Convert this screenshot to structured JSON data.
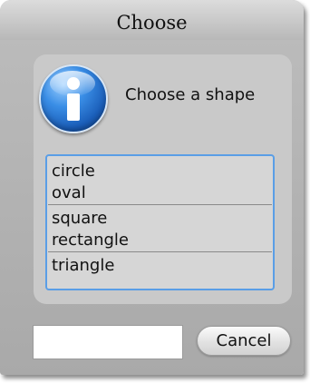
{
  "dialog": {
    "title": "Choose",
    "message": "Choose a shape",
    "icon": "info-icon",
    "list": {
      "groups": [
        [
          "circle",
          "oval"
        ],
        [
          "square",
          "rectangle"
        ],
        [
          "triangle"
        ]
      ]
    },
    "input": {
      "value": "",
      "placeholder": ""
    },
    "cancel_label": "Cancel"
  },
  "colors": {
    "list_focus_border": "#5a9ee6",
    "icon_blue": "#1a5db8"
  }
}
